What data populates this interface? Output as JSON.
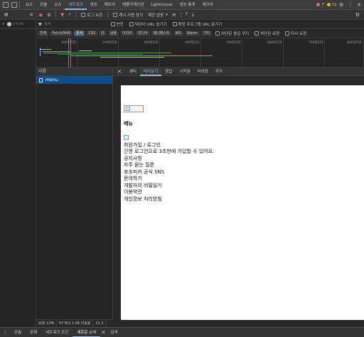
{
  "topbar": {
    "tabs": [
      "요소",
      "콘솔",
      "소스",
      "네트워크",
      "성능",
      "메모리",
      "애플리케이션",
      "Lighthouse",
      "성능 통계",
      "레이아"
    ],
    "active_tab": "네트워크",
    "error_count": "7",
    "warn_count": "11"
  },
  "leftpanel": {
    "filter_placeholder": "필터",
    "filter_chip": "Ac"
  },
  "toolbar": {
    "preserve_log": "로그 보존",
    "disable_cache": "캐시 사용 중지",
    "throttle": "제한 없음"
  },
  "filterbar": {
    "placeholder": "필터",
    "invert": "반전",
    "hide_data_urls": "데이터 URL 숨기기",
    "hide_ext_urls": "확장 프로그램 URL 숨기기"
  },
  "type_chips": [
    "전체",
    "Fetch/XHR",
    "문서",
    "CSS",
    "JS",
    "글꼴",
    "이미지",
    "미디어",
    "매니페스트",
    "WS",
    "Wasm",
    "기타"
  ],
  "active_chip": "문서",
  "extra_filters": {
    "blocked_cookies": "차단된 응답 쿠키",
    "blocked_requests": "차단된 요청",
    "third_party": "타사 요청"
  },
  "timeline": {
    "ticks": [
      "100밀리초",
      "200밀리초",
      "300밀리초",
      "400밀리초",
      "500밀리초",
      "600밀리초",
      "700밀리초",
      "800밀리초"
    ]
  },
  "namecol": {
    "header": "이름",
    "row": "menu"
  },
  "status": {
    "requests": "요청 1/36",
    "transferred": "67 B/1.1 kB 전송됨",
    "resources": "11.3"
  },
  "detail": {
    "tabs": [
      "헤더",
      "미리보기",
      "응답",
      "시작점",
      "타이밍",
      "쿠키"
    ],
    "active_tab": "미리보기"
  },
  "preview": {
    "heading": "메뉴",
    "lines": [
      "회원가입 / 로그인",
      "간편 로그인으로 3초만에 가입할 수 있어요.",
      "공지사항",
      "자주 묻는 질문",
      "포조피커 공식 SNS",
      "문의하기",
      "개발자의 비밀일기",
      "이용약관",
      "개인정보 처리방침"
    ]
  },
  "drawer": {
    "tabs": [
      "콘솔",
      "문제",
      "네트워크 조건",
      "새로운 소식",
      "검색"
    ],
    "active_tab": "새로운 소식"
  },
  "colors": {
    "accent": "#8ab4f8",
    "selected_row": "#0b4f8a",
    "error": "#e46962",
    "warning": "#f2b600"
  }
}
